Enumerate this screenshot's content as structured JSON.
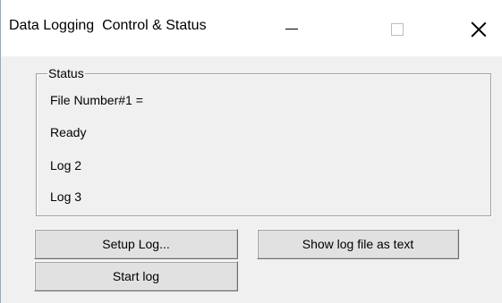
{
  "window": {
    "title": "Data Logging  Control & Status",
    "controls": [
      "minimize-icon",
      "maximize-icon",
      "close-icon"
    ]
  },
  "status_group": {
    "legend": "Status",
    "lines": [
      "File Number#1 =",
      "Ready",
      "Log 2",
      "Log 3"
    ]
  },
  "buttons": {
    "setup_log": "Setup Log...",
    "show_log_text": "Show log file as text",
    "start_log": "Start log"
  }
}
